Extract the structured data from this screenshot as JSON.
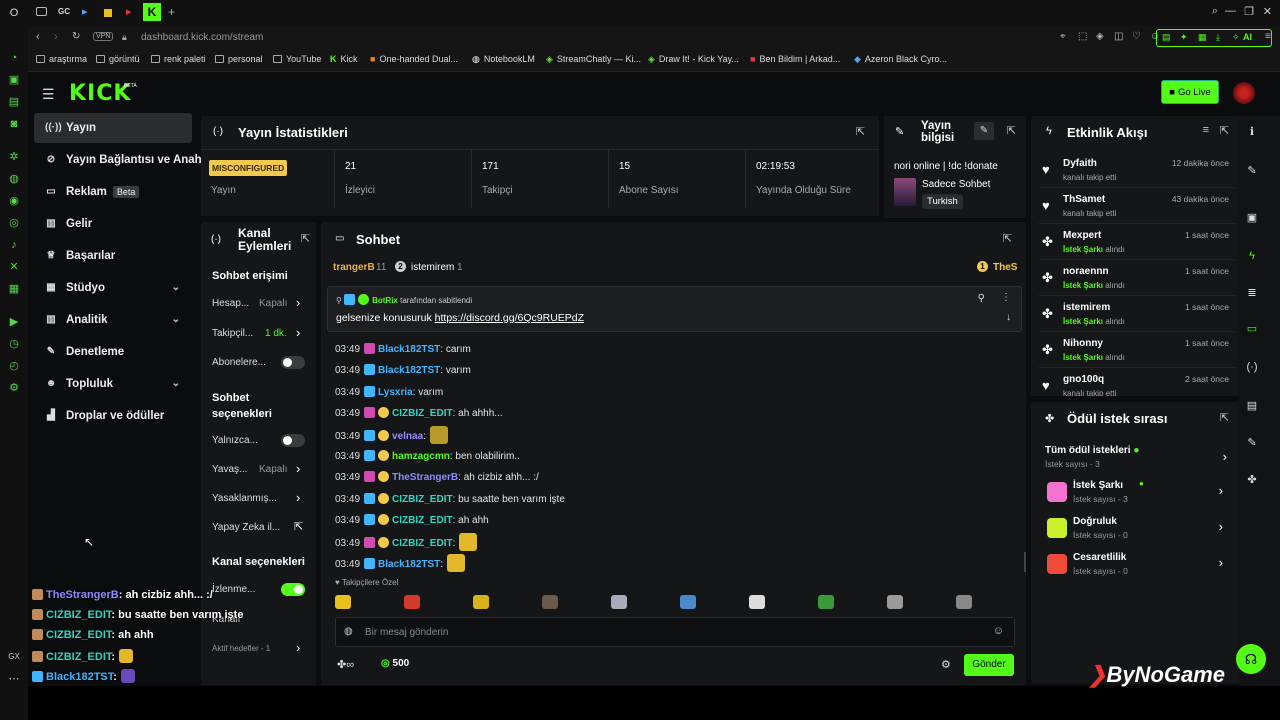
{
  "browser": {
    "tabs": [
      "GC"
    ],
    "url": "dashboard.kick.com/stream",
    "vpn": "VPN",
    "ai": "AI",
    "bookmarks": [
      "araştırma",
      "görüntü",
      "renk paleti",
      "personal",
      "YouTube",
      "Kick",
      "One-handed Dual...",
      "NotebookLM",
      "StreamChatly — Ki...",
      "Draw It! - Kick Yay...",
      "Ben Bildim | Arkad...",
      "Azeron Black Cyro..."
    ]
  },
  "header": {
    "logo": "KICK",
    "beta": "BETA",
    "go_live": "Go Live"
  },
  "sidebar": {
    "items": [
      {
        "label": "Yayın",
        "icon": "broadcast-icon"
      },
      {
        "label": "Yayın Bağlantısı ve Anahtarı",
        "icon": "link-icon"
      },
      {
        "label": "Reklam",
        "icon": "ad-icon",
        "badge": "Beta"
      },
      {
        "label": "Gelir",
        "icon": "income-icon"
      },
      {
        "label": "Başarılar",
        "icon": "trophy-icon"
      },
      {
        "label": "Stüdyo",
        "icon": "studio-icon"
      },
      {
        "label": "Analitik",
        "icon": "chart-icon"
      },
      {
        "label": "Denetleme",
        "icon": "wrench-icon"
      },
      {
        "label": "Topluluk",
        "icon": "people-icon"
      },
      {
        "label": "Droplar ve ödüller",
        "icon": "drops-icon"
      }
    ]
  },
  "stats": {
    "title": "Yayın İstatistikleri",
    "status": "MISCONFIGURED",
    "status_label": "Yayın",
    "viewers": "21",
    "viewers_label": "İzleyici",
    "followers": "171",
    "followers_label": "Takipçi",
    "subs": "15",
    "subs_label": "Abone Sayısı",
    "uptime": "02:19:53",
    "uptime_label": "Yayında Olduğu Süre"
  },
  "info": {
    "title1": "Yayın",
    "title2": "bilgisi",
    "stream_title": "nori online | !dc !donate",
    "category": "Sadece Sohbet",
    "language": "Turkish"
  },
  "events": {
    "title": "Etkinlik Akışı",
    "items": [
      {
        "name": "Dyfaith",
        "sub": "kanalı takip etti",
        "time": "12 dakika önce",
        "kind": "follow"
      },
      {
        "name": "ThSamet",
        "sub": "kanalı takip etti",
        "time": "43 dakika önce",
        "kind": "follow"
      },
      {
        "name": "Mexpert",
        "hl": "İstek Şarkı",
        "sub": "alındı",
        "time": "1 saat önce",
        "kind": "reward"
      },
      {
        "name": "noraennn",
        "hl": "İstek Şarkı",
        "sub": "alındı",
        "time": "1 saat önce",
        "kind": "reward"
      },
      {
        "name": "istemirem",
        "hl": "İstek Şarkı",
        "sub": "alındı",
        "time": "1 saat önce",
        "kind": "reward"
      },
      {
        "name": "Nihonny",
        "hl": "İstek Şarkı",
        "sub": "alındı",
        "time": "1 saat önce",
        "kind": "reward"
      },
      {
        "name": "gno100q",
        "sub": "kanalı takip etti",
        "time": "2 saat önce",
        "kind": "follow"
      }
    ]
  },
  "rewards": {
    "title": "Ödül istek sırası",
    "all": "Tüm ödül istekleri",
    "all_count": "İstek sayısı - 3",
    "items": [
      {
        "name": "İstek Şarkı",
        "count": "İstek sayısı - 3",
        "color": "#f472d0"
      },
      {
        "name": "Doğruluk",
        "count": "İstek sayısı - 0",
        "color": "#c8f02a"
      },
      {
        "name": "Cesaretlilik",
        "count": "İstek sayısı - 0",
        "color": "#ef4a3a"
      }
    ]
  },
  "actions": {
    "title1": "Kanal",
    "title2": "Eylemleri",
    "access": "Sohbet erişimi",
    "hesap": "Hesap...",
    "hesap_val": "Kapalı",
    "takip": "Takipçil...",
    "takip_val": "1 dk.",
    "abone": "Abonelere...",
    "chat_opts1": "Sohbet",
    "chat_opts2": "seçenekleri",
    "yalniz": "Yalnızca...",
    "yavas": "Yavaş...",
    "yavas_val": "Kapalı",
    "yasak": "Yasaklanmış...",
    "yapay": "Yapay Zeka il...",
    "kanal_opts": "Kanal seçenekleri",
    "izlenme": "İzlenme...",
    "kanali": "Kanalı",
    "aktif": "Aktif hedefler - 1"
  },
  "chat": {
    "title": "Sohbet",
    "top_user": "trangerB",
    "top_count": "11",
    "top_user2": "istemirem",
    "top_count2": "1",
    "top_user3": "TheS",
    "pinned_by": "BotRix",
    "pinned_suffix": "tarafından sabitlendi",
    "pinned_text": "gelsenize konusuruk",
    "pinned_link": "https://discord.gg/6Qc9RUEPdZ",
    "messages": [
      {
        "time": "03:49",
        "user": "Black182TST",
        "text": ": carım",
        "color": "#3fb6ff"
      },
      {
        "time": "03:49",
        "user": "Black182TST",
        "text": ": varım",
        "color": "#3fb6ff"
      },
      {
        "time": "03:49",
        "user": "Lysxria",
        "text": ": varım",
        "color": "#3fb6ff"
      },
      {
        "time": "03:49",
        "user": "CIZBIZ_EDIT",
        "text": ": ah ahhh...",
        "color": "#2fd6c4"
      },
      {
        "time": "03:49",
        "user": "velnaa",
        "text": ":",
        "color": "#9b8cff"
      },
      {
        "time": "03:49",
        "user": "hamzagcmn",
        "text": ": ben olabilirim..",
        "color": "#53fc18"
      },
      {
        "time": "03:49",
        "user": "TheStrangerB",
        "text": ": ah cizbiz ahh... :/",
        "color": "#8a8cff"
      },
      {
        "time": "03:49",
        "user": "CIZBIZ_EDIT",
        "text": ": bu saatte ben varım işte",
        "color": "#2fd6c4"
      },
      {
        "time": "03:49",
        "user": "CIZBIZ_EDIT",
        "text": ": ah ahh",
        "color": "#2fd6c4"
      },
      {
        "time": "03:49",
        "user": "CIZBIZ_EDIT",
        "text": ":",
        "color": "#2fd6c4"
      },
      {
        "time": "03:49",
        "user": "Black182TST",
        "text": ":",
        "color": "#3fb6ff"
      }
    ],
    "followers_only": "Takipçilere Özel",
    "placeholder": "Bir mesaj gönderin",
    "points": "500",
    "send": "Gönder"
  },
  "overlay": [
    {
      "user": "TheStrangerB",
      "text": ": ah cizbiz ahh... :/",
      "color": "#8a8cff"
    },
    {
      "user": "CIZBIZ_EDIT",
      "text": ": bu saatte ben varım işte",
      "color": "#2fd6c4"
    },
    {
      "user": "CIZBIZ_EDIT",
      "text": ": ah ahh",
      "color": "#2fd6c4"
    },
    {
      "user": "CIZBIZ_EDIT",
      "text": ":",
      "color": "#2fd6c4"
    },
    {
      "user": "Black182TST",
      "text": ":",
      "color": "#3fb6ff"
    }
  ],
  "watermark": "ByNoGame",
  "colors": {
    "accent": "#53fc18",
    "panel": "#151618",
    "bg": "#0b0c0d"
  }
}
